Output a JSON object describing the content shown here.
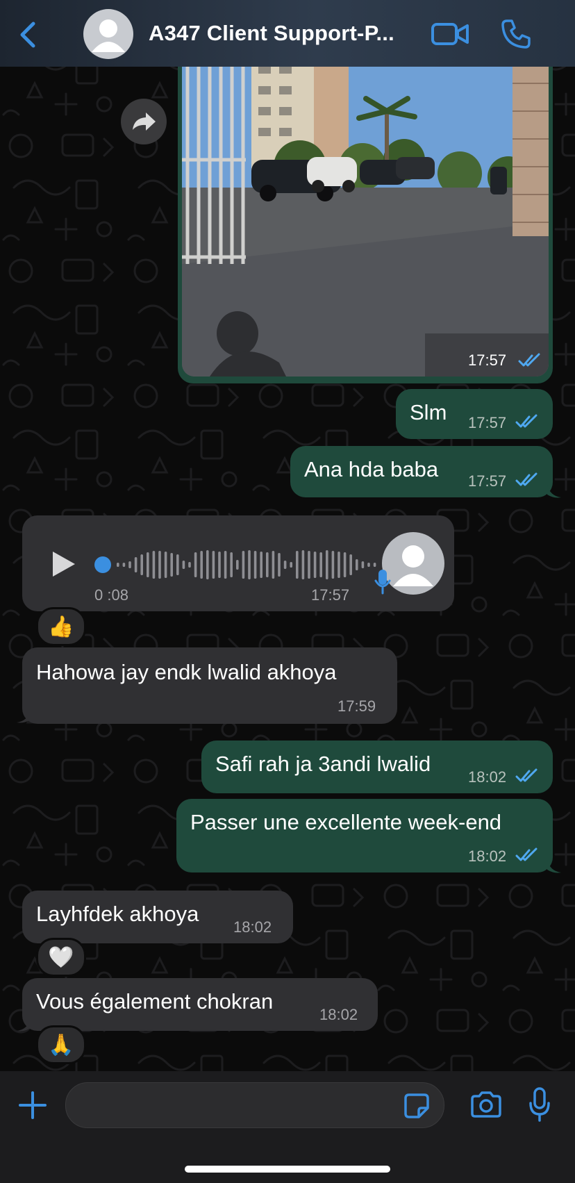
{
  "header": {
    "title": "A347 Client Support-P...",
    "icons": [
      "back-icon",
      "contact-avatar",
      "video-call-icon",
      "phone-call-icon"
    ]
  },
  "colors": {
    "outgoing_bubble": "#1f4a3c",
    "incoming_bubble": "#303033",
    "accent": "#3b8fe0",
    "read_ticks": "#4fa8f0"
  },
  "messages": [
    {
      "type": "image",
      "direction": "out",
      "time": "17:57",
      "status": "read"
    },
    {
      "type": "text",
      "direction": "out",
      "text": "Slm",
      "time": "17:57",
      "status": "read"
    },
    {
      "type": "text",
      "direction": "out",
      "text": "Ana hda baba",
      "time": "17:57",
      "status": "read"
    },
    {
      "type": "voice",
      "direction": "in",
      "duration": "0 :08",
      "time": "17:57",
      "reaction": "👍"
    },
    {
      "type": "text",
      "direction": "in",
      "text": "Hahowa jay endk lwalid akhoya",
      "time": "17:59"
    },
    {
      "type": "text",
      "direction": "out",
      "text": "Safi rah ja 3andi lwalid",
      "time": "18:02",
      "status": "read"
    },
    {
      "type": "text",
      "direction": "out",
      "text": "Passer une excellente week-end",
      "time": "18:02",
      "status": "read"
    },
    {
      "type": "text",
      "direction": "in",
      "text": "Layhfdek akhoya",
      "time": "18:02",
      "reaction": "🤍"
    },
    {
      "type": "text",
      "direction": "in",
      "text": "Vous également chokran",
      "time": "18:02",
      "reaction": "🙏"
    }
  ],
  "composer": {
    "icons": [
      "plus-icon",
      "sticker-icon",
      "camera-icon",
      "microphone-icon"
    ]
  }
}
